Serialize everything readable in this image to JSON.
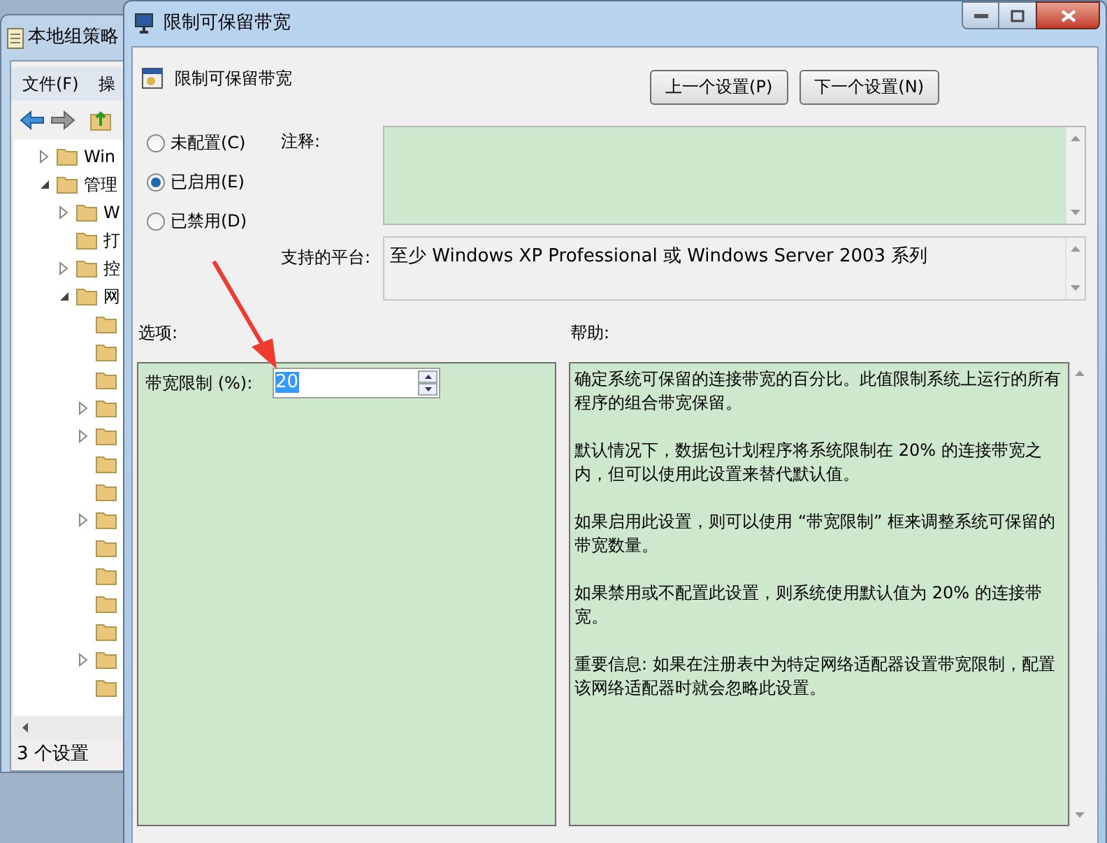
{
  "background_window": {
    "title": "本地组策略",
    "menu": [
      "文件(F)",
      "操"
    ],
    "tree": [
      {
        "label": "Win",
        "kind": "collapsed"
      },
      {
        "label": "管理",
        "kind": "expanded",
        "children": [
          {
            "label": "W",
            "kind": "collapsed"
          },
          {
            "label": "打",
            "kind": "leaf"
          },
          {
            "label": "控",
            "kind": "collapsed"
          },
          {
            "label": "网",
            "kind": "expanded",
            "children": [
              {
                "kind": "leaf"
              },
              {
                "kind": "leaf"
              },
              {
                "kind": "leaf"
              },
              {
                "kind": "collapsed"
              },
              {
                "kind": "collapsed"
              },
              {
                "kind": "leaf"
              },
              {
                "kind": "leaf"
              },
              {
                "kind": "collapsed"
              },
              {
                "kind": "leaf"
              },
              {
                "kind": "leaf"
              },
              {
                "kind": "leaf"
              },
              {
                "kind": "leaf"
              },
              {
                "kind": "collapsed"
              },
              {
                "kind": "leaf"
              }
            ]
          }
        ]
      }
    ],
    "status_bar": "3 个设置"
  },
  "dialog": {
    "title": "限制可保留带宽",
    "heading": "限制可保留带宽",
    "buttons": [
      "上一个设置(P)",
      "下一个设置(N)"
    ],
    "radios": [
      {
        "label": "未配置(C)",
        "selected": false
      },
      {
        "label": "已启用(E)",
        "selected": true
      },
      {
        "label": "已禁用(D)",
        "selected": false
      }
    ],
    "comment_label": "注释:",
    "platform_label": "支持的平台:",
    "platform": "至少 Windows XP Professional 或 Windows Server 2003 系列",
    "options_label": "选项:",
    "help_label": "帮助:",
    "options": [
      {
        "label": "带宽限制 (%):",
        "value": "20"
      }
    ],
    "help": [
      "确定系统可保留的连接带宽的百分比。此值限制系统上运行的所有程序的组合带宽保留。",
      "默认情况下，数据包计划程序将系统限制在 20% 的连接带宽之内，但可以使用此设置来替代默认值。",
      "如果启用此设置，则可以使用 “带宽限制” 框来调整系统可保留的带宽数量。",
      "如果禁用或不配置此设置，则系统使用默认值为 20% 的连接带宽。",
      "重要信息: 如果在注册表中为特定网络适配器设置带宽限制，配置该网络适配器时就会忽略此设置。"
    ]
  }
}
